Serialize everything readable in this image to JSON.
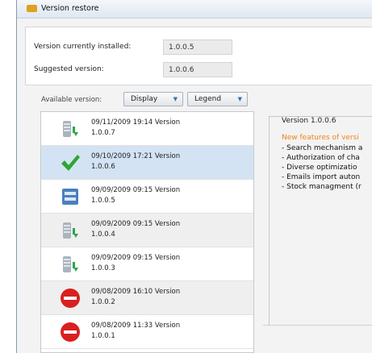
{
  "window": {
    "title": "Version restore"
  },
  "info": {
    "installed_label": "Version currently installed:",
    "installed_value": "1.0.0.5",
    "suggested_label": "Suggested version:",
    "suggested_value": "1.0.0.6"
  },
  "toolbar": {
    "available_label": "Available version:",
    "display_label": "Display",
    "legend_label": "Legend"
  },
  "versions": [
    {
      "line1": "09/11/2009 19:14 Version",
      "line2": "1.0.0.7",
      "icon": "server-pending-icon",
      "state": "normal"
    },
    {
      "line1": "09/10/2009 17:21 Version",
      "line2": "1.0.0.6",
      "icon": "checkmark-icon",
      "state": "selected"
    },
    {
      "line1": "09/09/2009 09:15 Version",
      "line2": "1.0.0.5",
      "icon": "installed-package-icon",
      "state": "normal"
    },
    {
      "line1": "09/09/2009 09:15 Version",
      "line2": "1.0.0.4",
      "icon": "server-pending-icon",
      "state": "alt"
    },
    {
      "line1": "09/09/2009 09:15 Version",
      "line2": "1.0.0.3",
      "icon": "server-pending-icon",
      "state": "normal"
    },
    {
      "line1": "09/08/2009 16:10 Version",
      "line2": "1.0.0.2",
      "icon": "blocked-icon",
      "state": "alt"
    },
    {
      "line1": "09/08/2009 11:33 Version",
      "line2": "1.0.0.1",
      "icon": "blocked-icon",
      "state": "normal"
    }
  ],
  "details": {
    "legend": "Version 1.0.0.6",
    "features_title": "New features of versi",
    "features": [
      "- Search mechanism a",
      "- Authorization of cha",
      "- Diverse optimizatio",
      "- Emails import auton",
      "- Stock managment (r"
    ]
  },
  "colors": {
    "accent": "#f0811a",
    "selection": "#d3e3f3",
    "check": "#2ea62e",
    "blocked": "#d82020"
  }
}
